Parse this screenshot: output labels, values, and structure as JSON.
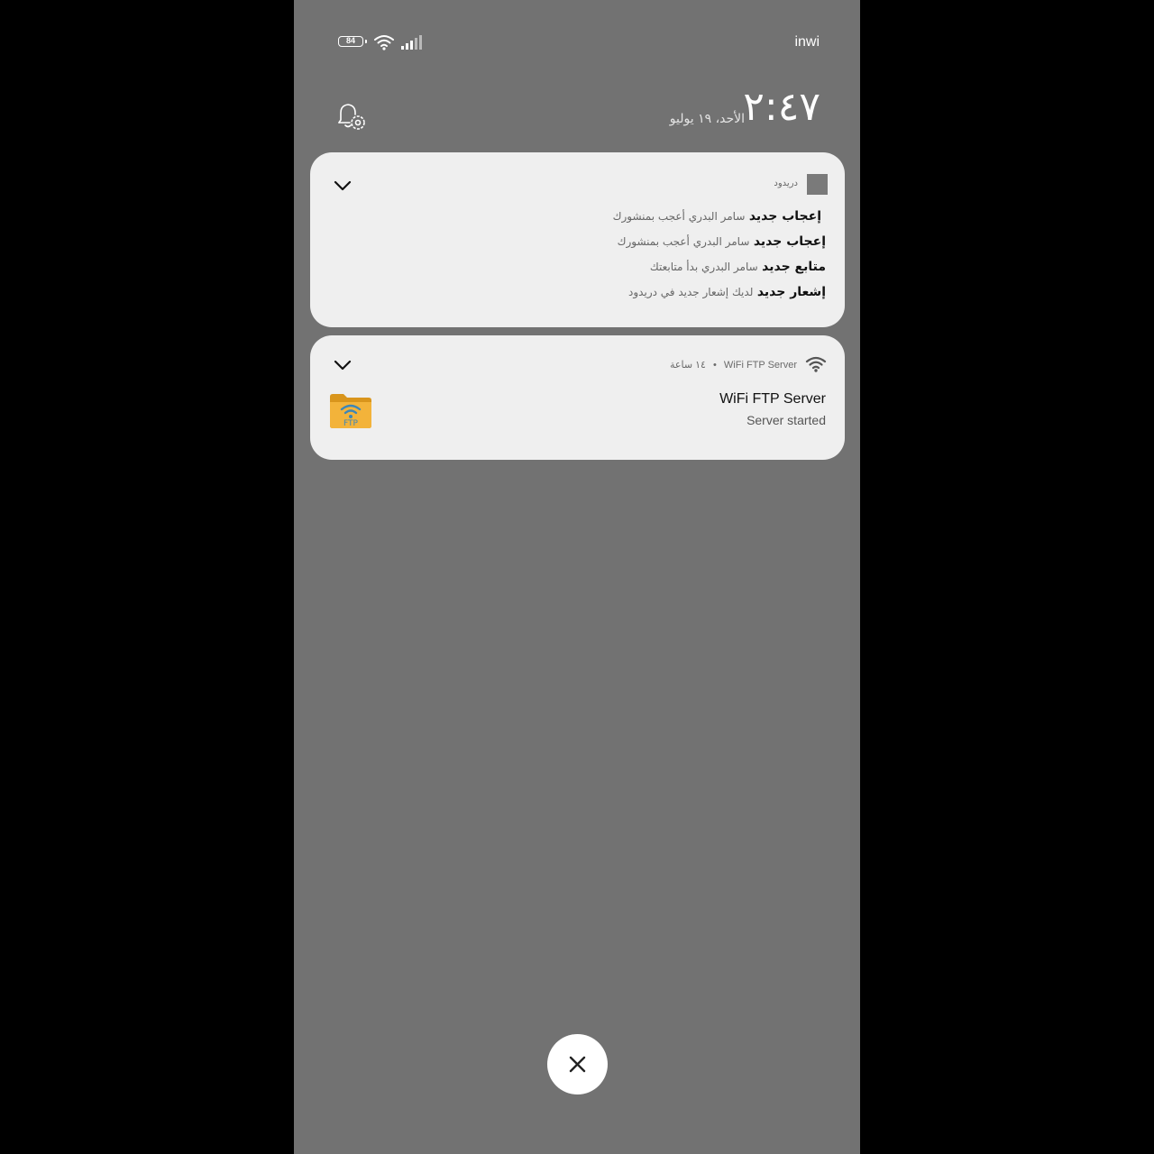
{
  "status_bar": {
    "battery_level": "84",
    "carrier": "inwi",
    "icons": [
      "battery-icon",
      "wifi-icon",
      "cell-signal-icon"
    ]
  },
  "header": {
    "time": "٢:٤٧",
    "date": "الأحد، ١٩ يوليو",
    "settings_icon": "bell-settings-icon"
  },
  "notifications": [
    {
      "app": "دريدود",
      "icon": "app-square-icon",
      "lines": [
        {
          "title": "إعجاب جديد",
          "body": "سامر البدري أعجب بمنشورك"
        },
        {
          "title": "إعجاب جديد",
          "body": "سامر البدري أعجب بمنشورك"
        },
        {
          "title": "متابع جديد",
          "body": "سامر البدري بدأ متابعتك"
        },
        {
          "title": "إشعار جديد",
          "body": "لديك إشعار جديد في دريدود"
        }
      ]
    },
    {
      "app": "WiFi FTP Server",
      "time_ago": "١٤ ساعة",
      "separator": "•",
      "icon": "wifi-icon",
      "title": "WiFi FTP Server",
      "subtitle": "Server started",
      "large_icon": "ftp-folder-icon"
    }
  ],
  "dismiss_all": {
    "icon": "close-icon"
  },
  "colors": {
    "shade_background": "#727272",
    "card_background": "#efefef",
    "outer_background": "#000000"
  }
}
